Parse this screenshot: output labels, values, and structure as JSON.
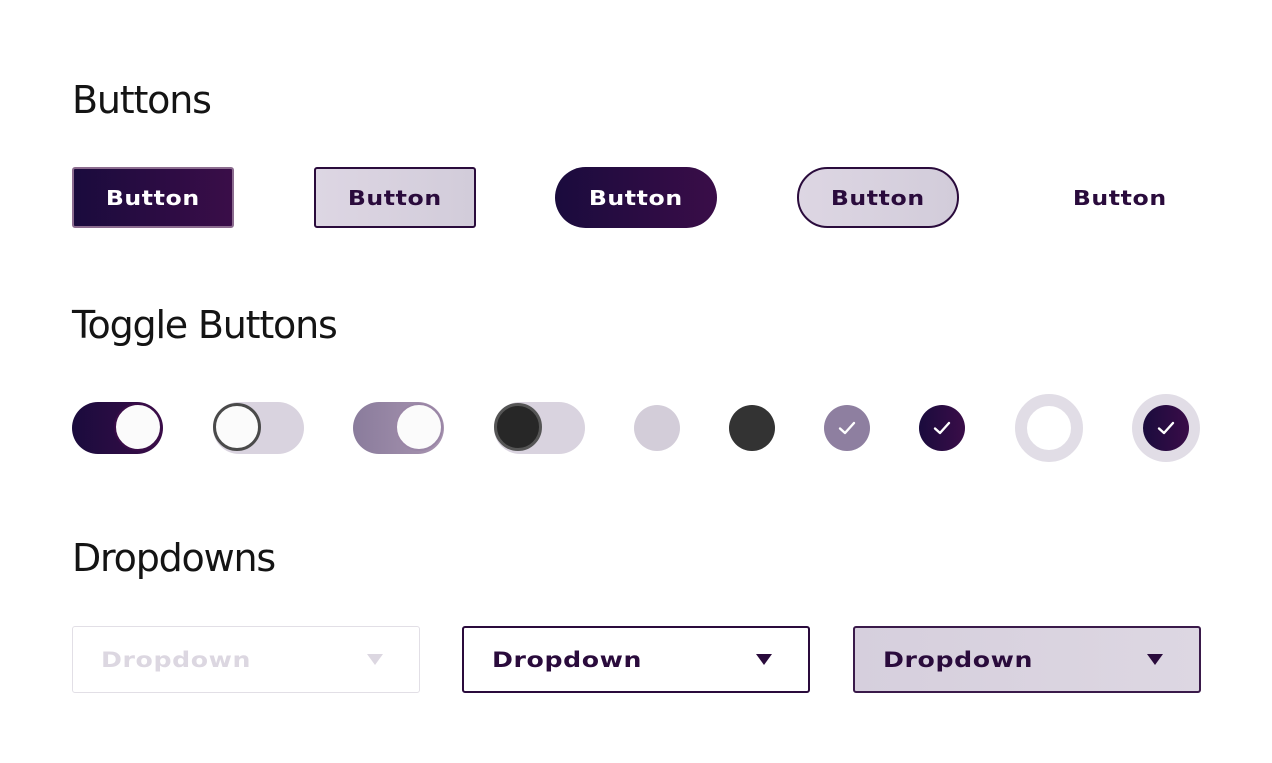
{
  "sections": {
    "buttons_title": "Buttons",
    "toggles_title": "Toggle Buttons",
    "dropdowns_title": "Dropdowns"
  },
  "buttons": [
    {
      "label": "Button",
      "variant": "filled-square"
    },
    {
      "label": "Button",
      "variant": "outlined-square"
    },
    {
      "label": "Button",
      "variant": "filled-pill"
    },
    {
      "label": "Button",
      "variant": "outlined-pill"
    },
    {
      "label": "Button",
      "variant": "text"
    }
  ],
  "toggles": [
    {
      "state": "on",
      "style": "dark"
    },
    {
      "state": "off",
      "style": "light-knob"
    },
    {
      "state": "on",
      "style": "muted"
    },
    {
      "state": "off",
      "style": "dark-knob"
    }
  ],
  "radios": [
    {
      "state": "unchecked",
      "style": "light"
    },
    {
      "state": "unchecked",
      "style": "dark"
    },
    {
      "state": "checked",
      "style": "muted",
      "icon": "check-icon"
    },
    {
      "state": "checked",
      "style": "dark",
      "icon": "check-icon"
    },
    {
      "state": "unchecked",
      "style": "focus-ring"
    },
    {
      "state": "checked",
      "style": "focus-ring",
      "icon": "check-icon"
    }
  ],
  "dropdowns": [
    {
      "label": "Dropdown",
      "state": "disabled",
      "icon": "caret-down-icon"
    },
    {
      "label": "Dropdown",
      "state": "outline",
      "icon": "caret-down-icon"
    },
    {
      "label": "Dropdown",
      "state": "filled",
      "icon": "caret-down-icon"
    }
  ],
  "colors": {
    "brand_dark": "#1a0b3d",
    "brand_plum": "#3a0d48",
    "brand_text": "#2a0b3c",
    "light_fill": "#d9d3df",
    "muted": "#8e7fa0",
    "disabled": "#dcd7e1"
  }
}
